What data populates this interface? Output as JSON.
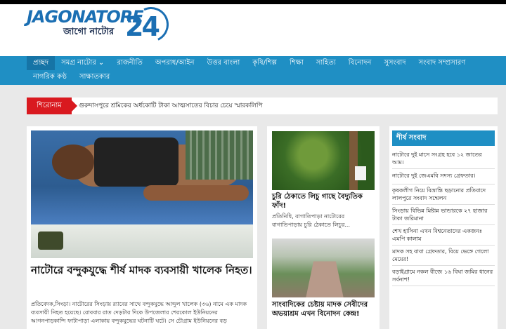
{
  "brand": {
    "name": "JAGONATORE",
    "sub": "জাগো নাটোর",
    "number": "24"
  },
  "nav": {
    "row1": [
      "প্রচ্ছদ",
      "সমগ্র নাটোর ⌄",
      "রাজনীতি",
      "অপরাধ/আইন",
      "উত্তর বাংলা",
      "কৃষি/শিল্প",
      "শিক্ষা",
      "সাহিত্য",
      "বিনোদন",
      "সুসংবাদ",
      "সংবাদ সম্প্রসারণ"
    ],
    "row2": [
      "নাগরিক কণ্ঠ",
      "সাক্ষাতকার"
    ]
  },
  "ticker": {
    "label": "শিরোনাম",
    "text": "গুরুদাসপুরে শ্রমিকের অর্ধকোটি টাকা আত্মসাতের বিচার চেয়ে স্মারকলিপি"
  },
  "lead": {
    "title": "নাটোরে বন্দুকযুদ্ধে শীর্ষ মাদক ব্যবসায়ী খালেক নিহত।",
    "excerpt": "প্রতিবেদক,সিংড়া। নাটোরের সিংড়ায় র‌্যাবের সাথে বন্দুকযুদ্ধে আব্দুল খালেক (৩৬) নামে এক মাদক ব্যবসায়ী নিহত হয়েছে। রোববার রাত দেড়টার দিকে উপজেলার শেরকোল ইউনিয়নের আগনপাড়কান্দি ফাটাপাড়া এলাকায় বন্দুকযুদ্ধের ঘটনাটি ঘটে। সে চৌগ্রাম ইউনিয়নের বড়"
  },
  "cards": [
    {
      "title": "চুরি ঠেকাতে লিচু গাছে বৈদ্যুতিক ফাঁদ!",
      "excerpt": "প্রতিনিধি, বাগাতিপাড়া নাটোরের বাগাতিপাড়ায় চুরি ঠেকাতে লিচুর..."
    },
    {
      "title": "সাংবাদিকের চেষ্টায় মাদক সেবীদের অভয়াশ্রম এখন বিনোদন কেন্দ্র!"
    }
  ],
  "sidebar": {
    "heading": "শীর্ষ সংবাদ",
    "items": [
      "নাটোরে দুই মাসে সংগ্রহ হবে ১২ জাতের আম।",
      "নাটোরে দুই জেএমবি সদস্য গ্রেফতার।",
      "কৃষকলীগ নিয়ে বিভ্রান্তি ছড়ানোর প্রতিবাদে লালপুরে সংবাদ সম্মেলন",
      "সিংড়ায় বিভিন্ন মিষ্টান্ন ভান্ডারকে ২৭ হাজার টাকা জরিমানা",
      "শেখ হাসিনা এখন বিশ্বনেতাদের একজনঃ এমপি কালাম",
      "মাদক সহ বাবা গ্রেফতার, বিয়ে ভেঙ্গে গেলো মেয়ের!",
      "বড়াইগ্রামে নকল বীজে ১৬ বিঘা জমির ধানের সর্বনাশ!"
    ]
  }
}
